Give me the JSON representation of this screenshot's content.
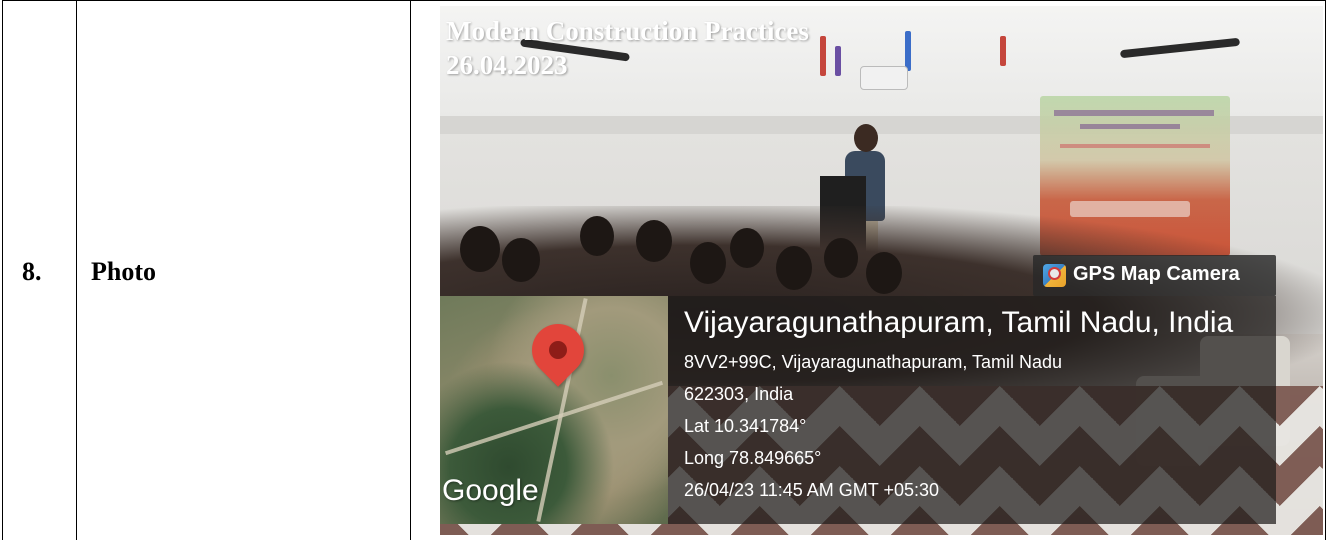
{
  "row": {
    "number": "8.",
    "label": "Photo"
  },
  "photo": {
    "caption_title": "Modern Construction Practices",
    "caption_date": "26.04.2023",
    "gps_tag": "GPS Map Camera",
    "map_logo": "Google",
    "location_title": "Vijayaragunathapuram, Tamil Nadu, India",
    "address_line1": "8VV2+99C, Vijayaragunathapuram, Tamil Nadu",
    "address_line2": "622303, India",
    "latitude": "Lat 10.341784°",
    "longitude": "Long 78.849665°",
    "timestamp": "26/04/23 11:45 AM GMT +05:30",
    "icons": [
      "gps-map-camera-icon",
      "map-pin-icon"
    ]
  }
}
